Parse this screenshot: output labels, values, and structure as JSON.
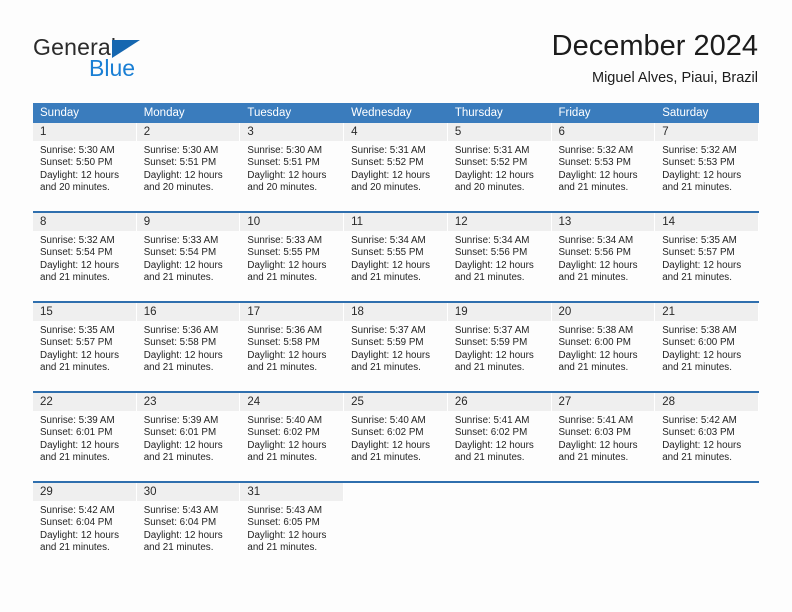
{
  "brand": {
    "word_one": "General",
    "word_two": "Blue",
    "triangle_icon": "blue-triangle-icon",
    "colors": {
      "general": "#2b2b2b",
      "blue": "#1a7fd4",
      "triangle": "#1667b0"
    }
  },
  "header": {
    "title": "December 2024",
    "subtitle": "Miguel Alves, Piaui, Brazil"
  },
  "theme": {
    "header_blue": "#3a7cbd",
    "separator_blue": "#2f6fae",
    "daynum_band": "#efefef",
    "page_background": "#fdfdfd",
    "text": "#242424"
  },
  "calendar": {
    "weekday_headers": [
      "Sunday",
      "Monday",
      "Tuesday",
      "Wednesday",
      "Thursday",
      "Friday",
      "Saturday"
    ],
    "weeks": [
      {
        "days": [
          {
            "num": "1",
            "sunrise": "Sunrise: 5:30 AM",
            "sunset": "Sunset: 5:50 PM",
            "daylight1": "Daylight: 12 hours",
            "daylight2": "and 20 minutes."
          },
          {
            "num": "2",
            "sunrise": "Sunrise: 5:30 AM",
            "sunset": "Sunset: 5:51 PM",
            "daylight1": "Daylight: 12 hours",
            "daylight2": "and 20 minutes."
          },
          {
            "num": "3",
            "sunrise": "Sunrise: 5:30 AM",
            "sunset": "Sunset: 5:51 PM",
            "daylight1": "Daylight: 12 hours",
            "daylight2": "and 20 minutes."
          },
          {
            "num": "4",
            "sunrise": "Sunrise: 5:31 AM",
            "sunset": "Sunset: 5:52 PM",
            "daylight1": "Daylight: 12 hours",
            "daylight2": "and 20 minutes."
          },
          {
            "num": "5",
            "sunrise": "Sunrise: 5:31 AM",
            "sunset": "Sunset: 5:52 PM",
            "daylight1": "Daylight: 12 hours",
            "daylight2": "and 20 minutes."
          },
          {
            "num": "6",
            "sunrise": "Sunrise: 5:32 AM",
            "sunset": "Sunset: 5:53 PM",
            "daylight1": "Daylight: 12 hours",
            "daylight2": "and 21 minutes."
          },
          {
            "num": "7",
            "sunrise": "Sunrise: 5:32 AM",
            "sunset": "Sunset: 5:53 PM",
            "daylight1": "Daylight: 12 hours",
            "daylight2": "and 21 minutes."
          }
        ]
      },
      {
        "days": [
          {
            "num": "8",
            "sunrise": "Sunrise: 5:32 AM",
            "sunset": "Sunset: 5:54 PM",
            "daylight1": "Daylight: 12 hours",
            "daylight2": "and 21 minutes."
          },
          {
            "num": "9",
            "sunrise": "Sunrise: 5:33 AM",
            "sunset": "Sunset: 5:54 PM",
            "daylight1": "Daylight: 12 hours",
            "daylight2": "and 21 minutes."
          },
          {
            "num": "10",
            "sunrise": "Sunrise: 5:33 AM",
            "sunset": "Sunset: 5:55 PM",
            "daylight1": "Daylight: 12 hours",
            "daylight2": "and 21 minutes."
          },
          {
            "num": "11",
            "sunrise": "Sunrise: 5:34 AM",
            "sunset": "Sunset: 5:55 PM",
            "daylight1": "Daylight: 12 hours",
            "daylight2": "and 21 minutes."
          },
          {
            "num": "12",
            "sunrise": "Sunrise: 5:34 AM",
            "sunset": "Sunset: 5:56 PM",
            "daylight1": "Daylight: 12 hours",
            "daylight2": "and 21 minutes."
          },
          {
            "num": "13",
            "sunrise": "Sunrise: 5:34 AM",
            "sunset": "Sunset: 5:56 PM",
            "daylight1": "Daylight: 12 hours",
            "daylight2": "and 21 minutes."
          },
          {
            "num": "14",
            "sunrise": "Sunrise: 5:35 AM",
            "sunset": "Sunset: 5:57 PM",
            "daylight1": "Daylight: 12 hours",
            "daylight2": "and 21 minutes."
          }
        ]
      },
      {
        "days": [
          {
            "num": "15",
            "sunrise": "Sunrise: 5:35 AM",
            "sunset": "Sunset: 5:57 PM",
            "daylight1": "Daylight: 12 hours",
            "daylight2": "and 21 minutes."
          },
          {
            "num": "16",
            "sunrise": "Sunrise: 5:36 AM",
            "sunset": "Sunset: 5:58 PM",
            "daylight1": "Daylight: 12 hours",
            "daylight2": "and 21 minutes."
          },
          {
            "num": "17",
            "sunrise": "Sunrise: 5:36 AM",
            "sunset": "Sunset: 5:58 PM",
            "daylight1": "Daylight: 12 hours",
            "daylight2": "and 21 minutes."
          },
          {
            "num": "18",
            "sunrise": "Sunrise: 5:37 AM",
            "sunset": "Sunset: 5:59 PM",
            "daylight1": "Daylight: 12 hours",
            "daylight2": "and 21 minutes."
          },
          {
            "num": "19",
            "sunrise": "Sunrise: 5:37 AM",
            "sunset": "Sunset: 5:59 PM",
            "daylight1": "Daylight: 12 hours",
            "daylight2": "and 21 minutes."
          },
          {
            "num": "20",
            "sunrise": "Sunrise: 5:38 AM",
            "sunset": "Sunset: 6:00 PM",
            "daylight1": "Daylight: 12 hours",
            "daylight2": "and 21 minutes."
          },
          {
            "num": "21",
            "sunrise": "Sunrise: 5:38 AM",
            "sunset": "Sunset: 6:00 PM",
            "daylight1": "Daylight: 12 hours",
            "daylight2": "and 21 minutes."
          }
        ]
      },
      {
        "days": [
          {
            "num": "22",
            "sunrise": "Sunrise: 5:39 AM",
            "sunset": "Sunset: 6:01 PM",
            "daylight1": "Daylight: 12 hours",
            "daylight2": "and 21 minutes."
          },
          {
            "num": "23",
            "sunrise": "Sunrise: 5:39 AM",
            "sunset": "Sunset: 6:01 PM",
            "daylight1": "Daylight: 12 hours",
            "daylight2": "and 21 minutes."
          },
          {
            "num": "24",
            "sunrise": "Sunrise: 5:40 AM",
            "sunset": "Sunset: 6:02 PM",
            "daylight1": "Daylight: 12 hours",
            "daylight2": "and 21 minutes."
          },
          {
            "num": "25",
            "sunrise": "Sunrise: 5:40 AM",
            "sunset": "Sunset: 6:02 PM",
            "daylight1": "Daylight: 12 hours",
            "daylight2": "and 21 minutes."
          },
          {
            "num": "26",
            "sunrise": "Sunrise: 5:41 AM",
            "sunset": "Sunset: 6:02 PM",
            "daylight1": "Daylight: 12 hours",
            "daylight2": "and 21 minutes."
          },
          {
            "num": "27",
            "sunrise": "Sunrise: 5:41 AM",
            "sunset": "Sunset: 6:03 PM",
            "daylight1": "Daylight: 12 hours",
            "daylight2": "and 21 minutes."
          },
          {
            "num": "28",
            "sunrise": "Sunrise: 5:42 AM",
            "sunset": "Sunset: 6:03 PM",
            "daylight1": "Daylight: 12 hours",
            "daylight2": "and 21 minutes."
          }
        ]
      },
      {
        "days": [
          {
            "num": "29",
            "sunrise": "Sunrise: 5:42 AM",
            "sunset": "Sunset: 6:04 PM",
            "daylight1": "Daylight: 12 hours",
            "daylight2": "and 21 minutes."
          },
          {
            "num": "30",
            "sunrise": "Sunrise: 5:43 AM",
            "sunset": "Sunset: 6:04 PM",
            "daylight1": "Daylight: 12 hours",
            "daylight2": "and 21 minutes."
          },
          {
            "num": "31",
            "sunrise": "Sunrise: 5:43 AM",
            "sunset": "Sunset: 6:05 PM",
            "daylight1": "Daylight: 12 hours",
            "daylight2": "and 21 minutes."
          },
          {
            "num": "",
            "sunrise": "",
            "sunset": "",
            "daylight1": "",
            "daylight2": ""
          },
          {
            "num": "",
            "sunrise": "",
            "sunset": "",
            "daylight1": "",
            "daylight2": ""
          },
          {
            "num": "",
            "sunrise": "",
            "sunset": "",
            "daylight1": "",
            "daylight2": ""
          },
          {
            "num": "",
            "sunrise": "",
            "sunset": "",
            "daylight1": "",
            "daylight2": ""
          }
        ]
      }
    ]
  }
}
